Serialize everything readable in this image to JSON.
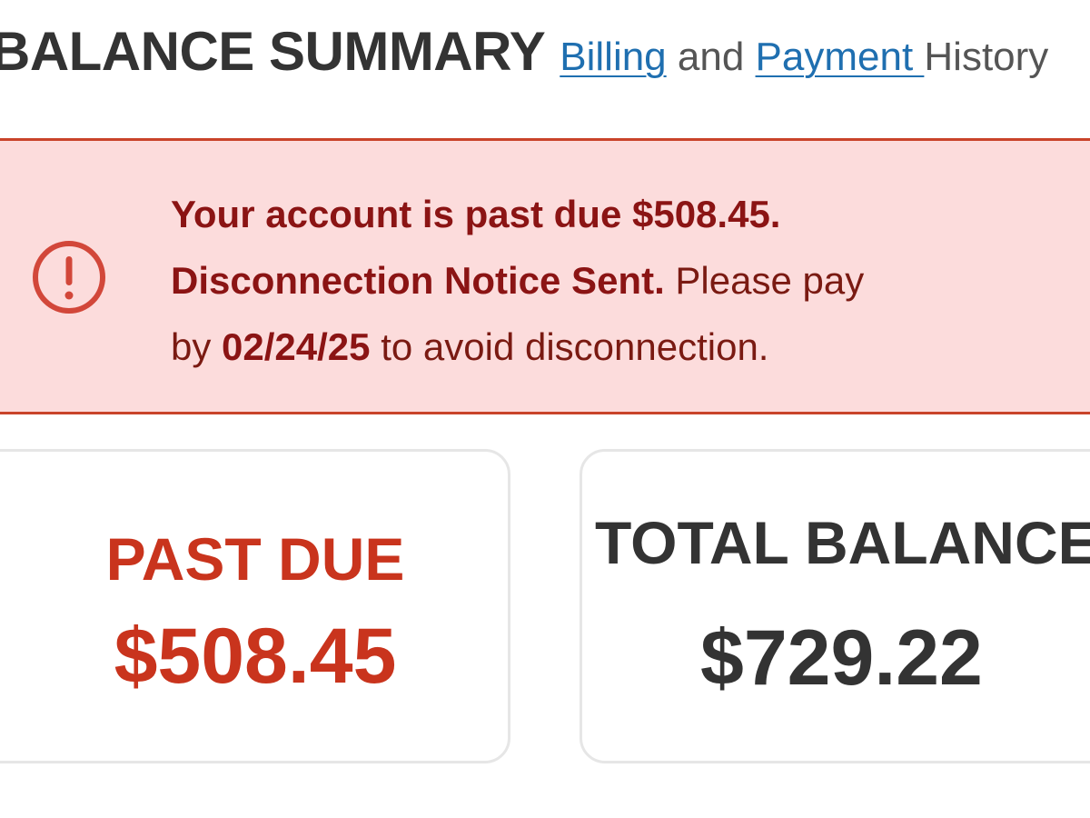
{
  "header": {
    "title": "BALANCE SUMMARY",
    "link_billing": "Billing",
    "and_text": " and ",
    "link_payment": "Payment ",
    "history_text": "History"
  },
  "alert": {
    "icon": "exclamation-circle-icon",
    "line1_bold": "Your account is past due $508.45.",
    "line2_bold": "Disconnection Notice Sent.",
    "line2_normal": " Please pay",
    "line3_prefix": "by ",
    "line3_date": "02/24/25",
    "line3_suffix": " to avoid disconnection."
  },
  "cards": {
    "past_due": {
      "label": "PAST DUE",
      "amount": "$508.45"
    },
    "total_balance": {
      "label": "TOTAL BALANCE",
      "amount": "$729.22"
    }
  },
  "colors": {
    "alert_background": "#fcdcdc",
    "alert_border": "#c9432a",
    "alert_text": "#8b1414",
    "past_due_red": "#c9341d",
    "link_blue": "#1f6fb0",
    "dark_text": "#333333"
  }
}
